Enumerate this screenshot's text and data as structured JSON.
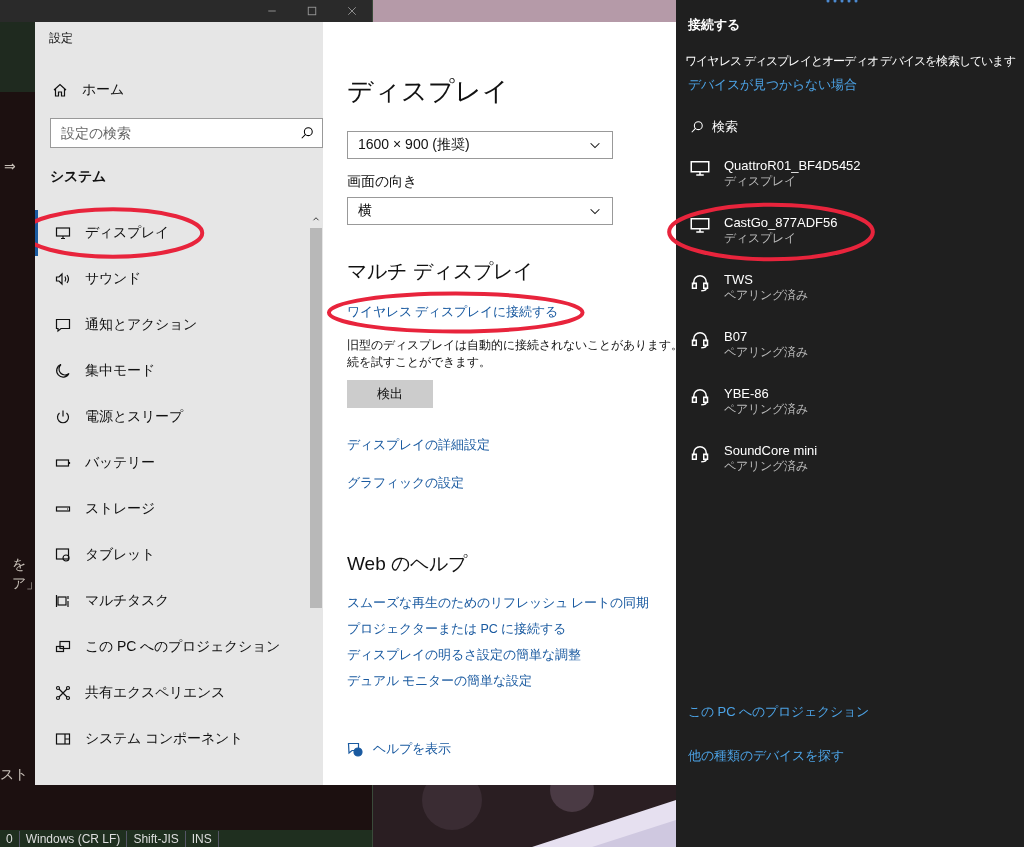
{
  "editor": {
    "fragments": [
      {
        "text": "⇒"
      },
      {
        "text": "を"
      },
      {
        "text": "ア」"
      },
      {
        "text": "スト"
      }
    ],
    "status_bar": [
      "0",
      "Windows (CR LF)",
      "Shift-JIS",
      "INS"
    ]
  },
  "settings": {
    "title": "設定",
    "home": "ホーム",
    "search": {
      "placeholder": "設定の検索"
    },
    "section": "システム",
    "nav": [
      {
        "label": "ディスプレイ",
        "selected": true,
        "circled": true
      },
      {
        "label": "サウンド",
        "selected": false,
        "circled": false
      },
      {
        "label": "通知とアクション",
        "selected": false,
        "circled": false
      },
      {
        "label": "集中モード",
        "selected": false,
        "circled": false
      },
      {
        "label": "電源とスリープ",
        "selected": false,
        "circled": false
      },
      {
        "label": "バッテリー",
        "selected": false,
        "circled": false
      },
      {
        "label": "ストレージ",
        "selected": false,
        "circled": false
      },
      {
        "label": "タブレット",
        "selected": false,
        "circled": false
      },
      {
        "label": "マルチタスク",
        "selected": false,
        "circled": false
      },
      {
        "label": "この PC へのプロジェクション",
        "selected": false,
        "circled": false
      },
      {
        "label": "共有エクスペリエンス",
        "selected": false,
        "circled": false
      },
      {
        "label": "システム コンポーネント",
        "selected": false,
        "circled": false
      }
    ],
    "content": {
      "heading": "ディスプレイ",
      "resolution": "1600 × 900 (推奨)",
      "orientation_label": "画面の向き",
      "orientation": "横",
      "multi_heading": "マルチ ディスプレイ",
      "wireless_link": {
        "text": "ワイヤレス ディスプレイに接続する",
        "circled": true
      },
      "note": [
        "旧型のディスプレイは自動的に接続されないことがあります。",
        "続を試すことができます。"
      ],
      "detect_button": "検出",
      "links": [
        "ディスプレイの詳細設定",
        "グラフィックの設定"
      ],
      "help_heading": "Web のヘルプ",
      "help_links": [
        "スムーズな再生のためのリフレッシュ レートの同期",
        "プロジェクターまたは PC に接続する",
        "ディスプレイの明るさ設定の簡単な調整",
        "デュアル モニターの簡単な設定"
      ],
      "show_help": "ヘルプを表示"
    }
  },
  "connect": {
    "title": "接続する",
    "status": "ワイヤレス ディスプレイとオーディオ デバイスを検索しています",
    "help_link": "デバイスが見つからない場合",
    "search": "検索",
    "devices": [
      {
        "kind": "display",
        "name": "QuattroR01_BF4D5452",
        "detail": "ディスプレイ",
        "circled": false
      },
      {
        "kind": "display",
        "name": "CastGo_877ADF56",
        "detail": "ディスプレイ",
        "circled": true
      },
      {
        "kind": "audio",
        "name": "TWS",
        "detail": "ペアリング済み",
        "circled": false
      },
      {
        "kind": "audio",
        "name": "B07",
        "detail": "ペアリング済み",
        "circled": false
      },
      {
        "kind": "audio",
        "name": "YBE-86",
        "detail": "ペアリング済み",
        "circled": false
      },
      {
        "kind": "audio",
        "name": "SoundCore mini",
        "detail": "ペアリング済み",
        "circled": false
      }
    ],
    "footer_links": [
      "この PC へのプロジェクション",
      "他の種類のデバイスを探す"
    ]
  }
}
